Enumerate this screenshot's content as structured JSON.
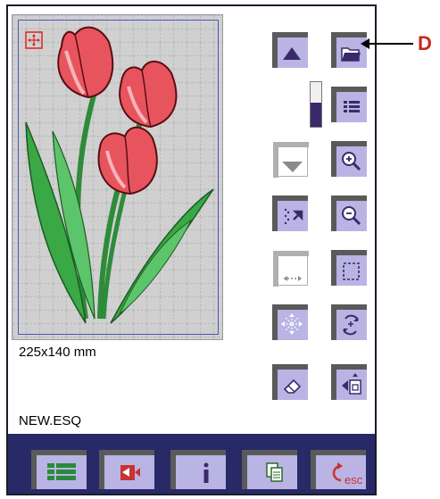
{
  "design": {
    "size_text": "225x140 mm",
    "file_name": "NEW.ESQ"
  },
  "slider": {
    "level": 0.55
  },
  "side_buttons": [
    {
      "name": "scroll-up-button",
      "icon": "triangle-up-icon"
    },
    {
      "name": "open-folder-button",
      "icon": "folder-open-icon"
    },
    {
      "name": "list-view-button",
      "icon": "list-icon"
    },
    {
      "name": "scroll-down-button",
      "icon": "triangle-down-icon"
    },
    {
      "name": "zoom-in-button",
      "icon": "zoom-in-icon"
    },
    {
      "name": "select-stitch-button",
      "icon": "cursor-select-icon"
    },
    {
      "name": "zoom-out-button",
      "icon": "zoom-out-icon"
    },
    {
      "name": "resize-button",
      "icon": "resize-horizontal-icon"
    },
    {
      "name": "zoom-to-hoop-button",
      "icon": "dashed-frame-icon"
    },
    {
      "name": "move-button",
      "icon": "move-arrows-icon"
    },
    {
      "name": "rotate-button",
      "icon": "rotate-icon"
    },
    {
      "name": "erase-button",
      "icon": "eraser-icon"
    },
    {
      "name": "hoop-position-button",
      "icon": "hoop-position-icon"
    }
  ],
  "bottom_buttons": [
    {
      "name": "menu-button",
      "icon": "list-icon"
    },
    {
      "name": "video-button",
      "icon": "camera-icon"
    },
    {
      "name": "info-button",
      "icon": "info-icon"
    },
    {
      "name": "copy-button",
      "icon": "copy-icon"
    },
    {
      "name": "escape-button",
      "icon": "esc-icon",
      "label": "esc"
    }
  ],
  "callout": {
    "letter": "D"
  },
  "colors": {
    "accent": "#b9b4e4",
    "bar": "#272a66",
    "hoop": "#4a57b8",
    "callout": "#c8281e"
  }
}
